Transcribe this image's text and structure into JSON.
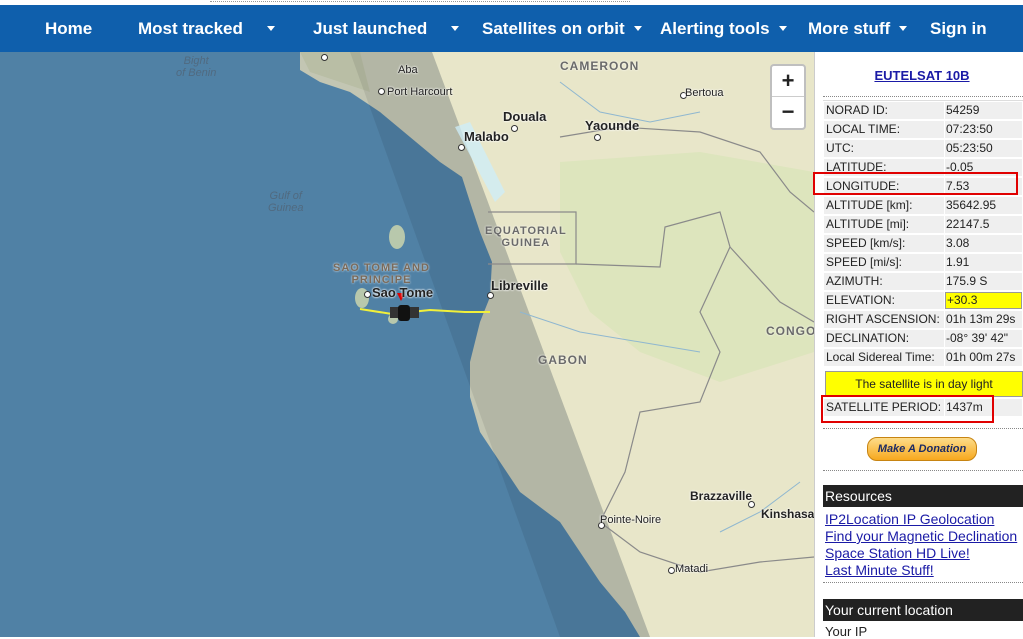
{
  "nav": {
    "items": [
      {
        "label": "Home",
        "dropdown": false
      },
      {
        "label": "Most tracked",
        "dropdown": true
      },
      {
        "label": "Just launched",
        "dropdown": true
      },
      {
        "label": "Satellites on orbit",
        "dropdown": true
      },
      {
        "label": "Alerting tools",
        "dropdown": true
      },
      {
        "label": "More stuff",
        "dropdown": true
      },
      {
        "label": "Sign in",
        "dropdown": false
      }
    ]
  },
  "map": {
    "zoom_in": "+",
    "zoom_out": "−",
    "labels": {
      "bight": "Bight\nof Benin",
      "abuja": "Aba",
      "port_harcourt": "Port Harcourt",
      "cameroon": "CAMEROON",
      "bertoua": "Bertoua",
      "douala": "Douala",
      "malabo": "Malabo",
      "yaounde": "Yaounde",
      "gulf": "Gulf of\nGuinea",
      "eq_guinea": "EQUATORIAL\nGUINEA",
      "sao_tome_country": "SAO TOME AND\nPRINCIPE",
      "sao_tome": "Sao Tome",
      "libreville": "Libreville",
      "congo": "CONGO",
      "gabon": "GABON",
      "brazzaville": "Brazzaville",
      "pointe_noire": "Pointe-Noire",
      "kinshasa": "Kinshasa",
      "matadi": "Matadi"
    }
  },
  "satellite": {
    "name": "EUTELSAT 10B",
    "rows": [
      {
        "k": "NORAD ID:",
        "v": "54259"
      },
      {
        "k": "LOCAL TIME:",
        "v": "07:23:50"
      },
      {
        "k": "UTC:",
        "v": "05:23:50"
      },
      {
        "k": "LATITUDE:",
        "v": "-0.05"
      },
      {
        "k": "LONGITUDE:",
        "v": "7.53"
      },
      {
        "k": "ALTITUDE [km]:",
        "v": "35642.95"
      },
      {
        "k": "ALTITUDE [mi]:",
        "v": "22147.5"
      },
      {
        "k": "SPEED [km/s]:",
        "v": "3.08"
      },
      {
        "k": "SPEED [mi/s]:",
        "v": "1.91"
      },
      {
        "k": "AZIMUTH:",
        "v": "175.9 S"
      },
      {
        "k": "ELEVATION:",
        "v": "+30.3"
      },
      {
        "k": "RIGHT ASCENSION:",
        "v": "01h 13m 29s"
      },
      {
        "k": "DECLINATION:",
        "v": "-08° 39' 42\""
      },
      {
        "k": "Local Sidereal Time:",
        "v": "01h 00m 27s"
      }
    ],
    "daylight": "The satellite is in day light",
    "period_label": "SATELLITE PERIOD:",
    "period_value": "1437m"
  },
  "donate": "Make A Donation",
  "resources": {
    "title": "Resources",
    "links": [
      "IP2Location IP Geolocation",
      "Find your Magnetic Declination",
      "Space Station HD Live!",
      "Last Minute Stuff!"
    ]
  },
  "location": {
    "title": "Your current location",
    "ip_label": "Your IP"
  }
}
